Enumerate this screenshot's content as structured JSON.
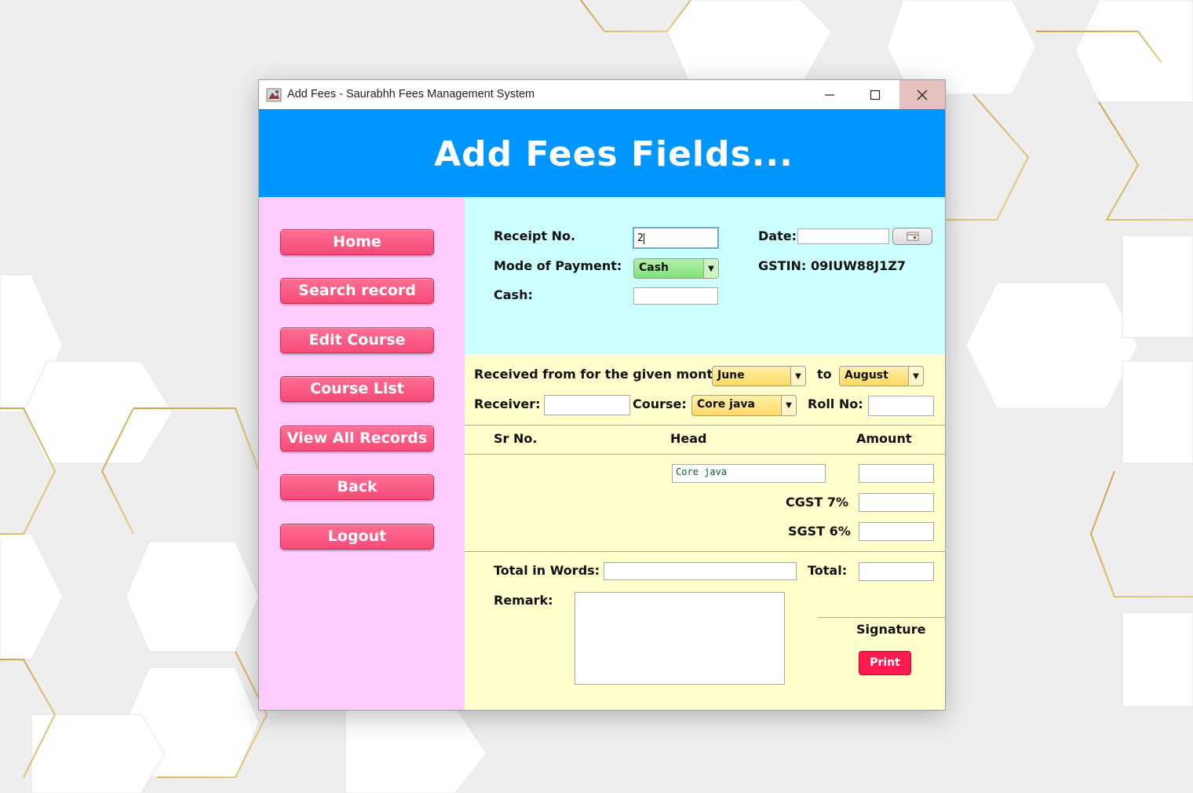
{
  "window": {
    "title": "Add Fees - Saurabhh Fees Management System",
    "icons": {
      "app": "app-icon",
      "minimize": "minimize-icon",
      "maximize": "maximize-icon",
      "close": "close-icon"
    }
  },
  "header": {
    "title": "Add Fees Fields..."
  },
  "sidebar": {
    "items": [
      {
        "label": "Home"
      },
      {
        "label": "Search record"
      },
      {
        "label": "Edit Course"
      },
      {
        "label": "Course List"
      },
      {
        "label": "View All Records"
      },
      {
        "label": "Back"
      },
      {
        "label": "Logout"
      }
    ]
  },
  "receipt": {
    "receipt_no_label": "Receipt No.",
    "receipt_no_value": "2",
    "date_label": "Date:",
    "date_value": "",
    "mode_label": "Mode of Payment:",
    "mode_value": "Cash",
    "gstin_label": "GSTIN:",
    "gstin_value": "09IUW88J1Z7",
    "cash_label": "Cash:",
    "cash_value": ""
  },
  "period": {
    "received_label": "Received from for the given month",
    "from_month": "June",
    "to_label": "to",
    "to_month": "August",
    "receiver_label": "Receiver:",
    "receiver_value": "",
    "course_label": "Course:",
    "course_value": "Core java",
    "roll_label": "Roll No:",
    "roll_value": ""
  },
  "table": {
    "headers": {
      "sr": "Sr No.",
      "head": "Head",
      "amount": "Amount"
    },
    "head_value": "Core java",
    "amount_value": "",
    "cgst_label": "CGST 7%",
    "cgst_value": "",
    "sgst_label": "SGST 6%",
    "sgst_value": ""
  },
  "footer": {
    "total_words_label": "Total in Words:",
    "total_words_value": "",
    "total_label": "Total:",
    "total_value": "",
    "remark_label": "Remark:",
    "remark_value": "",
    "signature_label": "Signature",
    "print_label": "Print"
  },
  "colors": {
    "header_bg": "#0096ff",
    "sidebar_bg": "#ffccff",
    "top_panel_bg": "#ccffff",
    "bottom_panel_bg": "#ffffcc",
    "nav_button": "#f54a78",
    "print_button": "#ff1a4f"
  }
}
